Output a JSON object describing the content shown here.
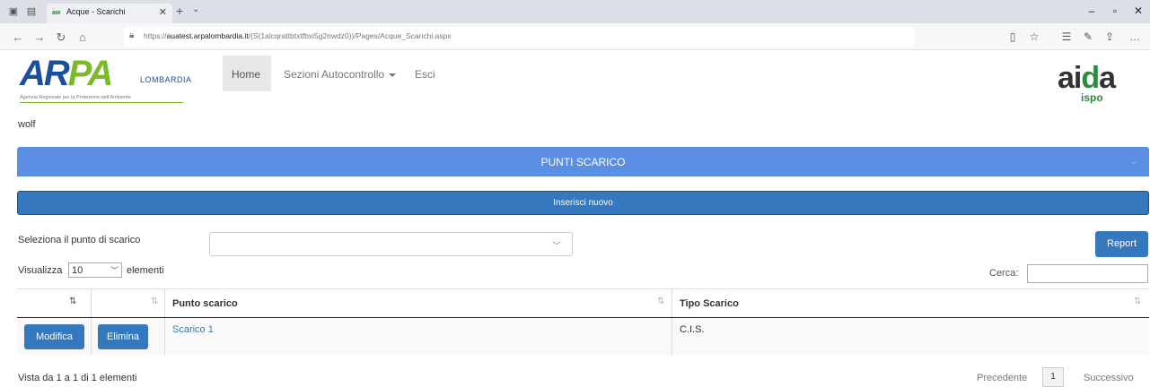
{
  "browser": {
    "tab_title": "Acque - Scarichi",
    "url_host": "auatest.arpalombardia.it",
    "url_rest": "/(S(1alcqrattbtxtfbxi5g2nwdz0))/Pages/Acque_Scarichi.aspx",
    "url_prefix": "https://"
  },
  "header": {
    "logo_text_1": "AR",
    "logo_text_2": "PA",
    "logo_region": "LOMBARDIA",
    "logo_subtitle": "Agenzia Regionale per la Protezione dell'Ambiente",
    "nav": {
      "home": "Home",
      "sections": "Sezioni Autocontrollo",
      "exit": "Esci"
    },
    "aida_1": "ai",
    "aida_2": "d",
    "aida_3": "a",
    "aida_sub": "ispo",
    "user": "wolf"
  },
  "panel": {
    "title": "PUNTI SCARICO",
    "new_button": "Inserisci nuovo",
    "select_label": "Seleziona il punto di scarico",
    "select_value": "",
    "report_button": "Report",
    "length_prefix": "Visualizza",
    "length_value": "10",
    "length_suffix": "elementi",
    "search_label": "Cerca:",
    "search_value": ""
  },
  "table": {
    "columns": [
      "",
      "",
      "Punto scarico",
      "Tipo Scarico"
    ],
    "rows": [
      {
        "edit": "Modifica",
        "delete": "Elimina",
        "punto": "Scarico 1",
        "tipo": "C.I.S."
      }
    ]
  },
  "footer": {
    "info": "Vista da 1 a 1 di 1 elementi",
    "prev": "Precedente",
    "page": "1",
    "next": "Successivo"
  }
}
